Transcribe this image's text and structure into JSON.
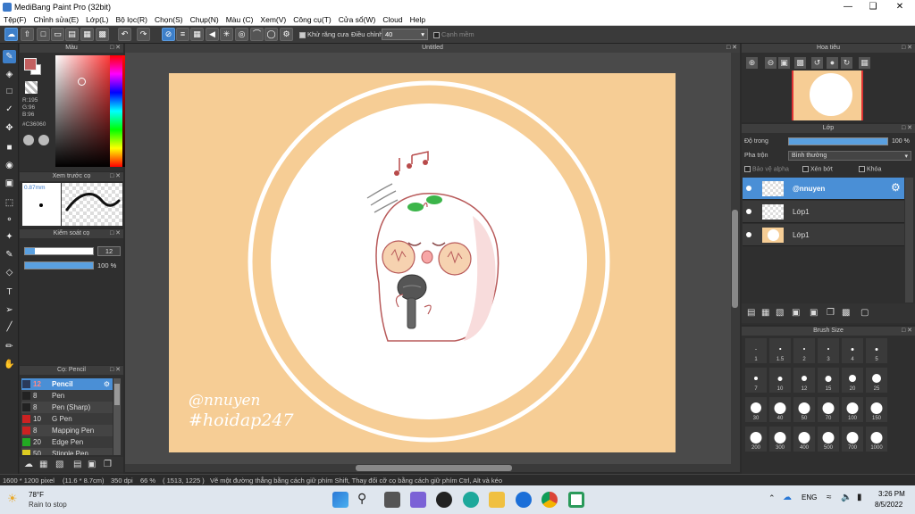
{
  "window": {
    "title": "MediBang Paint Pro (32bit)"
  },
  "menu": [
    "Tệp(F)",
    "Chỉnh sửa(E)",
    "Lớp(L)",
    "Bộ lọc(R)",
    "Chọn(S)",
    "Chụp(N)",
    "Màu (C)",
    "Xem(V)",
    "Công cụ(T)",
    "Cửa sổ(W)",
    "Cloud",
    "Help"
  ],
  "toolbar": {
    "antialias_label": "Khử răng cưa",
    "correction_label": "Điều chỉnh",
    "correction_value": "40",
    "soft_edge_label": "Cạnh mềm"
  },
  "color_panel": {
    "title": "Màu",
    "r": "R:195",
    "g": "G:96",
    "b": "B:96",
    "hex": "#C36060",
    "main_color": "#c36060"
  },
  "brush_preview": {
    "title": "Xem trước cọ",
    "size": "0.87mm"
  },
  "brush_control": {
    "title": "Kiểm soát cọ",
    "size_value": "12",
    "opacity_value": "100 %"
  },
  "brush_list": {
    "title": "Cọ: Pencil",
    "items": [
      {
        "num": "12",
        "name": "Pencil",
        "color": "#2a3a5a",
        "selected": true
      },
      {
        "num": "8",
        "name": "Pen",
        "color": "#222222"
      },
      {
        "num": "8",
        "name": "Pen (Sharp)",
        "color": "#222222"
      },
      {
        "num": "10",
        "name": "G Pen",
        "color": "#cc2222"
      },
      {
        "num": "8",
        "name": "Mapping Pen",
        "color": "#cc2222"
      },
      {
        "num": "20",
        "name": "Edge Pen",
        "color": "#22aa22"
      },
      {
        "num": "50",
        "name": "Stipple Pen",
        "color": "#ddcc22"
      }
    ]
  },
  "document": {
    "tab": "Untitled",
    "watermark_line1": "@nnuyen",
    "watermark_line2": "#hoidap247",
    "bg_color": "#f6cd95"
  },
  "navigator": {
    "title": "Hoa tiêu"
  },
  "layers": {
    "title": "Lớp",
    "opacity_label": "Độ trong",
    "opacity_value": "100 %",
    "blend_label": "Pha trộn",
    "blend_value": "Bình thường",
    "protect_alpha": "Bảo vệ alpha",
    "clipping": "Xén bớt",
    "lock": "Khóa",
    "items": [
      {
        "name": "@nnuyen",
        "selected": true
      },
      {
        "name": "Lớp1",
        "selected": false
      },
      {
        "name": "Lớp1",
        "selected": false
      }
    ]
  },
  "brush_size": {
    "title": "Brush Size",
    "sizes": [
      "1",
      "1.5",
      "2",
      "3",
      "4",
      "5",
      "7",
      "10",
      "12",
      "15",
      "20",
      "25",
      "30",
      "40",
      "50",
      "70",
      "100",
      "150",
      "200",
      "300",
      "400",
      "500",
      "700",
      "1000"
    ]
  },
  "status": {
    "dims": "1600 * 1200 pixel",
    "cm": "(11.6 * 8.7cm)",
    "dpi": "350 dpi",
    "zoom": "66 %",
    "coords": "( 1513, 1225 )",
    "hint": "Vẽ một đường thẳng bằng cách giữ phím Shift, Thay đổi cỡ cọ bằng cách giữ phím Ctrl, Alt và kéo"
  },
  "taskbar": {
    "weather_temp": "78°F",
    "weather_desc": "Rain to stop",
    "lang": "ENG",
    "time": "3:26 PM",
    "date": "8/5/2022"
  }
}
